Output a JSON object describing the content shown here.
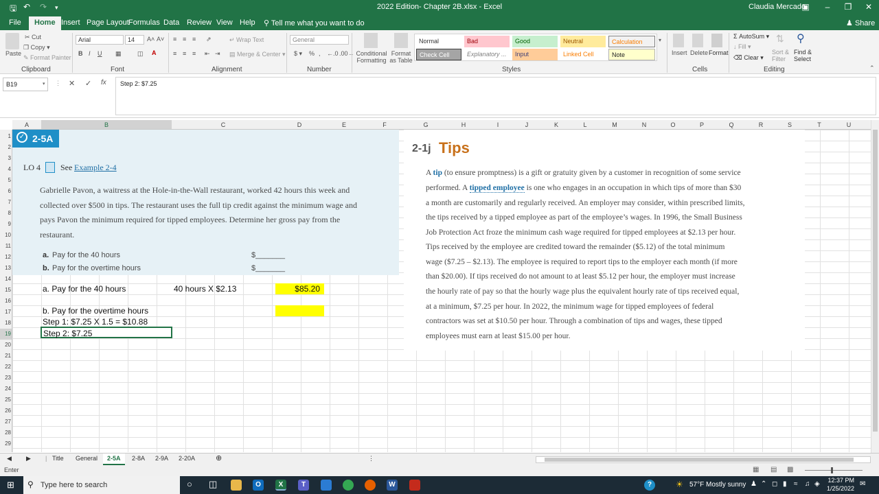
{
  "window": {
    "title": "2022 Edition- Chapter 2B.xlsx - Excel",
    "user": "Claudia Mercado"
  },
  "menu": {
    "tabs": [
      "File",
      "Home",
      "Insert",
      "Page Layout",
      "Formulas",
      "Data",
      "Review",
      "View",
      "Help"
    ],
    "tell_me": "Tell me what you want to do",
    "share": "Share"
  },
  "ribbon": {
    "clipboard": {
      "paste": "Paste",
      "cut": "Cut",
      "copy": "Copy",
      "format_painter": "Format Painter",
      "label": "Clipboard"
    },
    "font": {
      "name": "Arial",
      "size": "14",
      "label": "Font"
    },
    "alignment": {
      "wrap_text": "Wrap Text",
      "merge_center": "Merge & Center",
      "label": "Alignment"
    },
    "number": {
      "format": "General",
      "label": "Number"
    },
    "styles": {
      "conditional": "Conditional Formatting",
      "format_as_table": "Format as Table",
      "cells": [
        "Normal",
        "Bad",
        "Good",
        "Neutral",
        "Calculation",
        "Check Cell",
        "Explanatory ...",
        "Input",
        "Linked Cell",
        "Note"
      ],
      "label": "Styles"
    },
    "cells": {
      "insert": "Insert",
      "delete": "Delete",
      "format": "Format",
      "label": "Cells"
    },
    "editing": {
      "autosum": "AutoSum",
      "fill": "Fill",
      "clear": "Clear",
      "sort_filter": "Sort & Filter",
      "find_select": "Find & Select",
      "label": "Editing"
    }
  },
  "formula_bar": {
    "name_box": "B19",
    "content": "Step 2: $7.25"
  },
  "columns": [
    "A",
    "B",
    "C",
    "D",
    "E",
    "F",
    "G",
    "H",
    "I",
    "J",
    "K",
    "L",
    "M",
    "N",
    "O",
    "P",
    "Q",
    "R",
    "S",
    "T",
    "U"
  ],
  "rows": [
    "1",
    "2",
    "3",
    "4",
    "5",
    "6",
    "7",
    "8",
    "9",
    "10",
    "11",
    "12",
    "13",
    "14",
    "15",
    "16",
    "17",
    "18",
    "19",
    "20",
    "21",
    "22",
    "23",
    "24",
    "25",
    "26",
    "27",
    "28",
    "29"
  ],
  "problem": {
    "badge": "2-5A",
    "lo": "LO 4",
    "see": "See",
    "example_link": "Example 2-4",
    "text_lines": [
      "Gabrielle Pavon, a waitress at the Hole-in-the-Wall restaurant, worked 42 hours this week and",
      "collected over $500 in tips. The restaurant uses the full tip credit against the minimum wage and",
      "pays Pavon the minimum required for tipped employees. Determine her gross pay from the",
      "restaurant."
    ],
    "part_a_letter": "a.",
    "part_a": "Pay for the 40 hours",
    "part_b_letter": "b.",
    "part_b": "Pay for the overtime hours",
    "blank": "$_______"
  },
  "cells": {
    "b15": "a. Pay for the 40 hours",
    "c15": "40 hours X $2.13",
    "d15": "$85.20",
    "b17": "b. Pay for the overtime hours",
    "b18": "Step 1: $7.25 X 1.5 = $10.88",
    "b19": "Step 2: $7.25",
    "highlight_color": "#ffff00"
  },
  "tips": {
    "section": "2-1j",
    "heading": "Tips",
    "heading_color": "#c8711b",
    "line1_a": "A ",
    "line1_tip": "tip",
    "line1_b": " (to ensure promptness) is a gift or gratuity given by a customer in recognition of some service",
    "line2_a": "performed. A ",
    "line2_tipped": "tipped employee",
    "line2_b": " is one who engages in an occupation in which tips of more than $30",
    "lines": [
      "a month are customarily and regularly received. An employer may consider, within prescribed limits,",
      "the tips received by a tipped employee as part of the employee’s wages. In 1996, the Small Business",
      "Job Protection Act froze the minimum cash wage required for tipped employees at $2.13 per hour.",
      "Tips received by the employee are credited toward the remainder ($5.12) of the total minimum",
      "wage ($7.25 – $2.13). The employee is required to report tips to the employer each month (if more",
      "than $20.00). If tips received do not amount to at least $5.12 per hour, the employer must increase",
      "the hourly rate of pay so that the hourly wage plus the equivalent hourly rate of tips received equal,",
      "at a minimum, $7.25 per hour. In 2022, the minimum wage for tipped employees of federal",
      "contractors was set at $10.50 per hour. Through a combination of tips and wages, these tipped",
      "employees must earn at least $15.00 per hour."
    ]
  },
  "sheets": [
    "Title",
    "General",
    "2-5A",
    "2-8A",
    "2-9A",
    "2-20A"
  ],
  "active_sheet": "2-5A",
  "status": "Enter",
  "taskbar": {
    "search_placeholder": "Type here to search",
    "weather": "57°F  Mostly sunny",
    "time": "12:37 PM",
    "date": "1/25/2022"
  }
}
